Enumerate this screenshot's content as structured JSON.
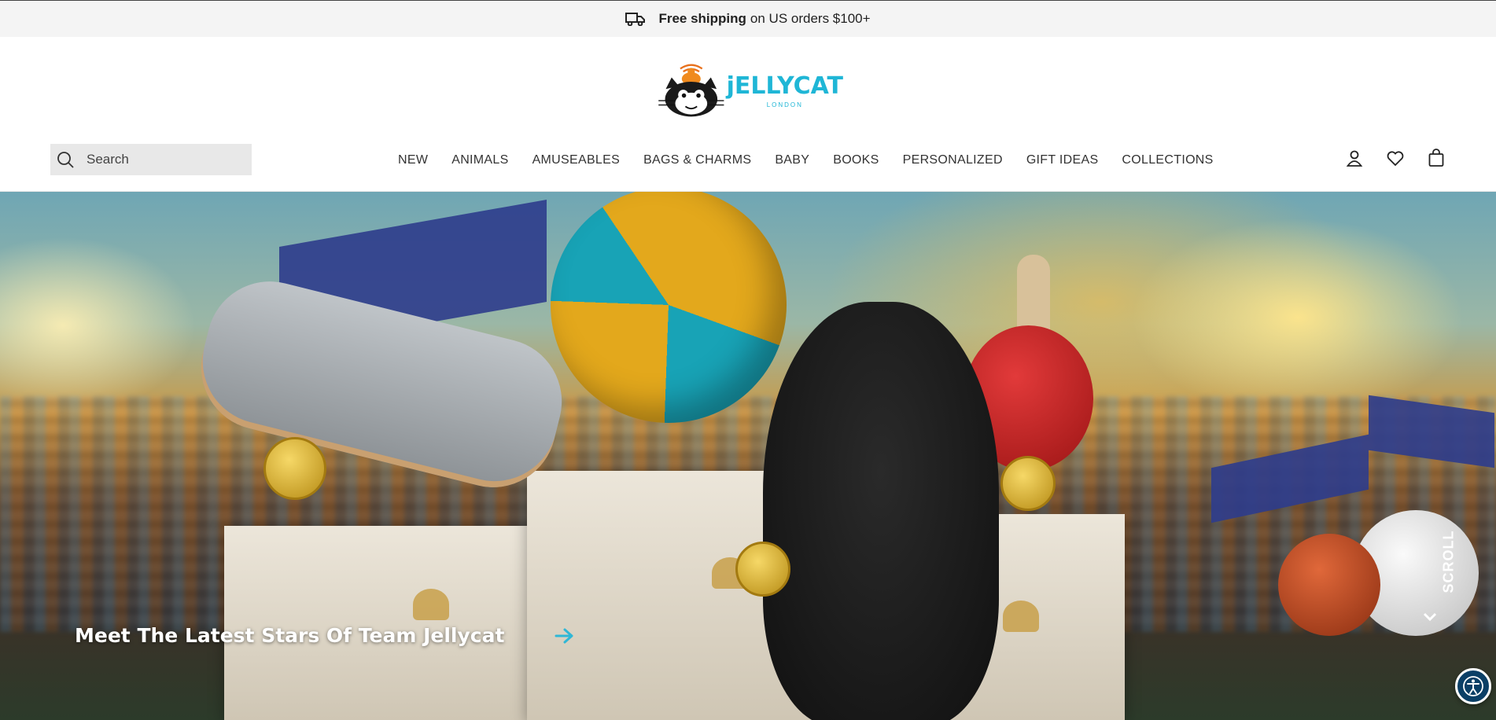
{
  "announcement": {
    "bold": "Free shipping",
    "text": "on US orders $100+",
    "icon": "truck-icon"
  },
  "brand": {
    "name": "jELLYCAT",
    "sub": "LONDON",
    "accent": "#1fb6d6"
  },
  "search": {
    "placeholder": "Search",
    "icon": "search-icon"
  },
  "nav": {
    "items": [
      {
        "label": "NEW"
      },
      {
        "label": "ANIMALS"
      },
      {
        "label": "AMUSEABLES"
      },
      {
        "label": "BAGS & CHARMS"
      },
      {
        "label": "BABY"
      },
      {
        "label": "BOOKS"
      },
      {
        "label": "PERSONALIZED"
      },
      {
        "label": "GIFT IDEAS"
      },
      {
        "label": "COLLECTIONS"
      }
    ]
  },
  "header_icons": [
    "account-icon",
    "wishlist-heart-icon",
    "cart-bag-icon"
  ],
  "hero": {
    "caption": "Meet The Latest Stars Of Team Jellycat",
    "arrow_color": "#2fb7d6",
    "scroll_label": "SCROLL"
  },
  "accessibility": {
    "icon": "accessibility-icon",
    "color": "#0b3f66"
  }
}
